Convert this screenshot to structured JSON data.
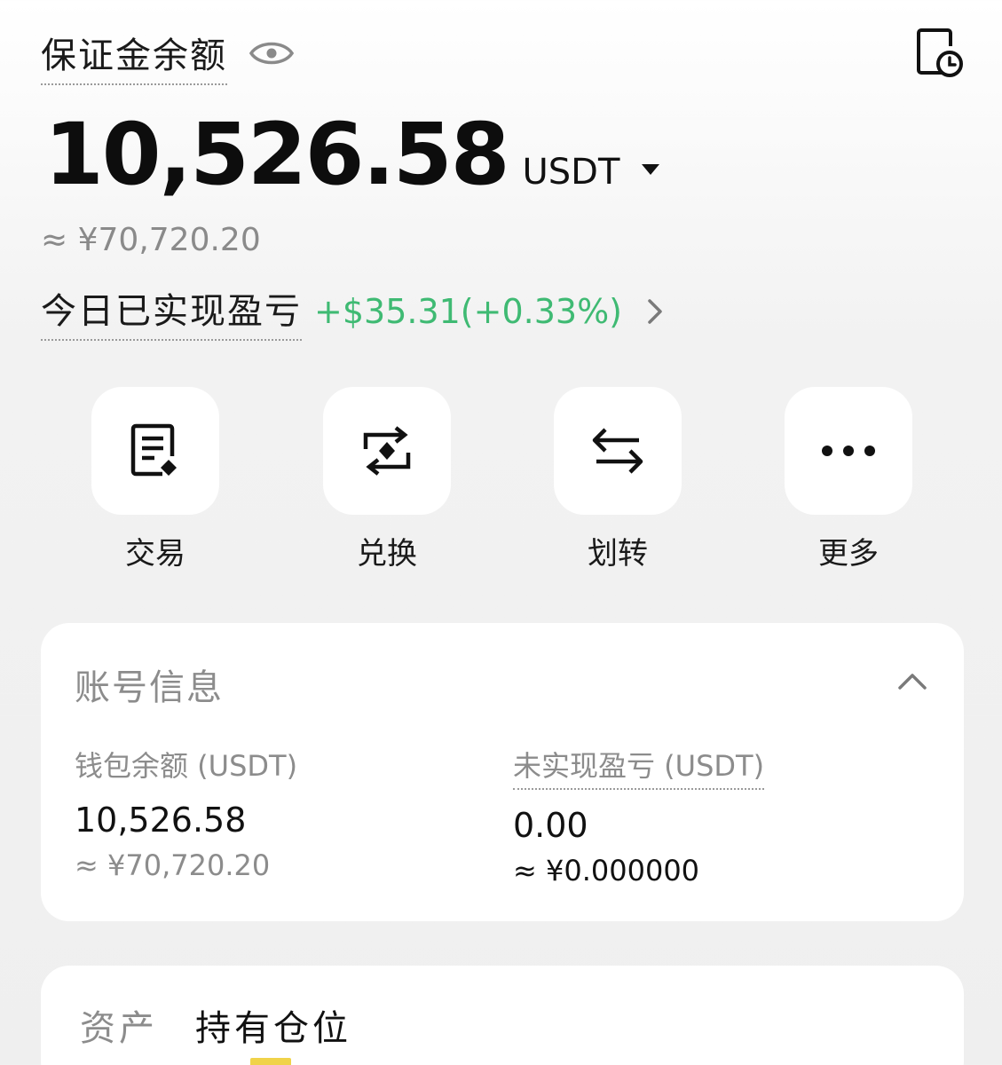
{
  "header": {
    "title": "保证金余额",
    "icons": {
      "visibility": "eye-icon",
      "history": "history-icon"
    }
  },
  "balance": {
    "value": "10,526.58",
    "unit": "USDT",
    "approx_cny": "≈ ¥70,720.20"
  },
  "pnl": {
    "label": "今日已实现盈亏",
    "value": "+$35.31(+0.33%)",
    "color": "#3fba73"
  },
  "actions": [
    {
      "label": "交易",
      "icon": "trade-icon"
    },
    {
      "label": "兑换",
      "icon": "convert-icon"
    },
    {
      "label": "划转",
      "icon": "transfer-icon"
    },
    {
      "label": "更多",
      "icon": "more-icon"
    }
  ],
  "account_info": {
    "title": "账号信息",
    "wallet_balance": {
      "label": "钱包余额 (USDT)",
      "value": "10,526.58",
      "approx": "≈ ¥70,720.20"
    },
    "unrealized_pnl": {
      "label": "未实现盈亏 (USDT)",
      "value": "0.00",
      "approx": "≈ ¥0.000000"
    }
  },
  "tabs": {
    "assets": "资产",
    "positions": "持有仓位",
    "active": "positions",
    "accent": "#f0d34a"
  }
}
